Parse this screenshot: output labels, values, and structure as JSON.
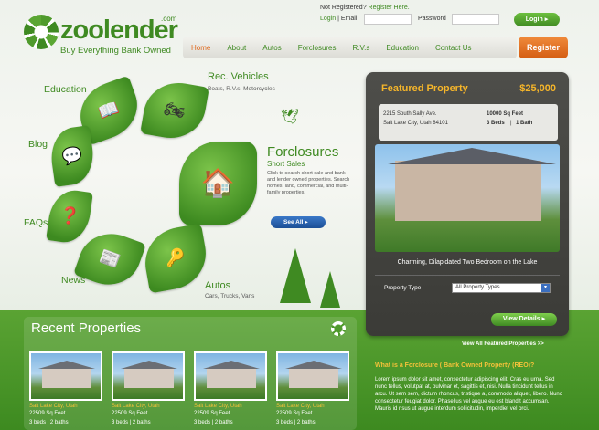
{
  "brand": {
    "name": "zoolender",
    "com": ".com",
    "tagline": "Buy Everything Bank Owned"
  },
  "login": {
    "not_registered": "Not Registered?",
    "register_here": "Register Here.",
    "login_link": "Login",
    "email_label": "| Email",
    "password_label": "Password",
    "button": "Login"
  },
  "nav": {
    "items": [
      "Home",
      "About",
      "Autos",
      "Forclosures",
      "R.V.s",
      "Education",
      "Contact Us"
    ],
    "register": "Register"
  },
  "petals": {
    "rec_title": "Rec. Vehicles",
    "rec_sub": "Boats, R.V.s, Motorcycles",
    "education": "Education",
    "blog": "Blog",
    "faqs": "FAQs",
    "news": "News",
    "autos_title": "Autos",
    "autos_sub": "Cars, Trucks, Vans",
    "forclosures_title": "Forclosures",
    "forclosures_sub": "Short Sales",
    "forclosures_desc": "Click to search short sale and bank and lender owned properties. Search homes, land, commercial, and multi-family properties.",
    "see_all": "See All"
  },
  "featured": {
    "title": "Featured Property",
    "price": "$25,000",
    "address1": "2215 South Sally Ave.",
    "address2": "Salt Lake City, Utah 84101",
    "sqft": "10000 Sq Feet",
    "beds": "3 Beds",
    "bath": "1 Bath",
    "caption": "Charming, Dilapidated Two Bedroom on the Lake",
    "ptype_label": "Property Type",
    "ptype_value": "All Property Types",
    "view_button": "View Details"
  },
  "recent": {
    "title": "Recent Properties",
    "items": [
      {
        "city": "Salt Lake City, Utah",
        "sqft": "22509 Sq Feet",
        "beds": "3 beds  |  2 baths"
      },
      {
        "city": "Salt Lake City, Utah",
        "sqft": "22509 Sq Feet",
        "beds": "3 beds  |  2 baths"
      },
      {
        "city": "Salt Lake City, Utah",
        "sqft": "22509 Sq Feet",
        "beds": "3 beds  |  2 baths"
      },
      {
        "city": "Salt Lake City, Utah",
        "sqft": "22509 Sq Feet",
        "beds": "3 beds  |  2 baths"
      }
    ]
  },
  "all_featured_link": "View All Featured Properties >>",
  "faq": {
    "title": "What is a Forclosure ( Bank Owned Property (REO)?",
    "body": "Lorem ipsum dolor sit amet, consectetur adipiscing elit. Cras eu urna. Sed nunc tellus, volutpat at, pulvinar et, sagittis et, nisi. Nulla tincidunt tellus in arcu. Ut sem sem, dictum rhoncus, tristique a, commodo aliquet, libero. Nunc consectetur feugiat dolor. Phasellus vel augue eu est blandit accumsan. Mauris id risus ut augue interdum sollicitudin, imperdiet vel orci."
  }
}
